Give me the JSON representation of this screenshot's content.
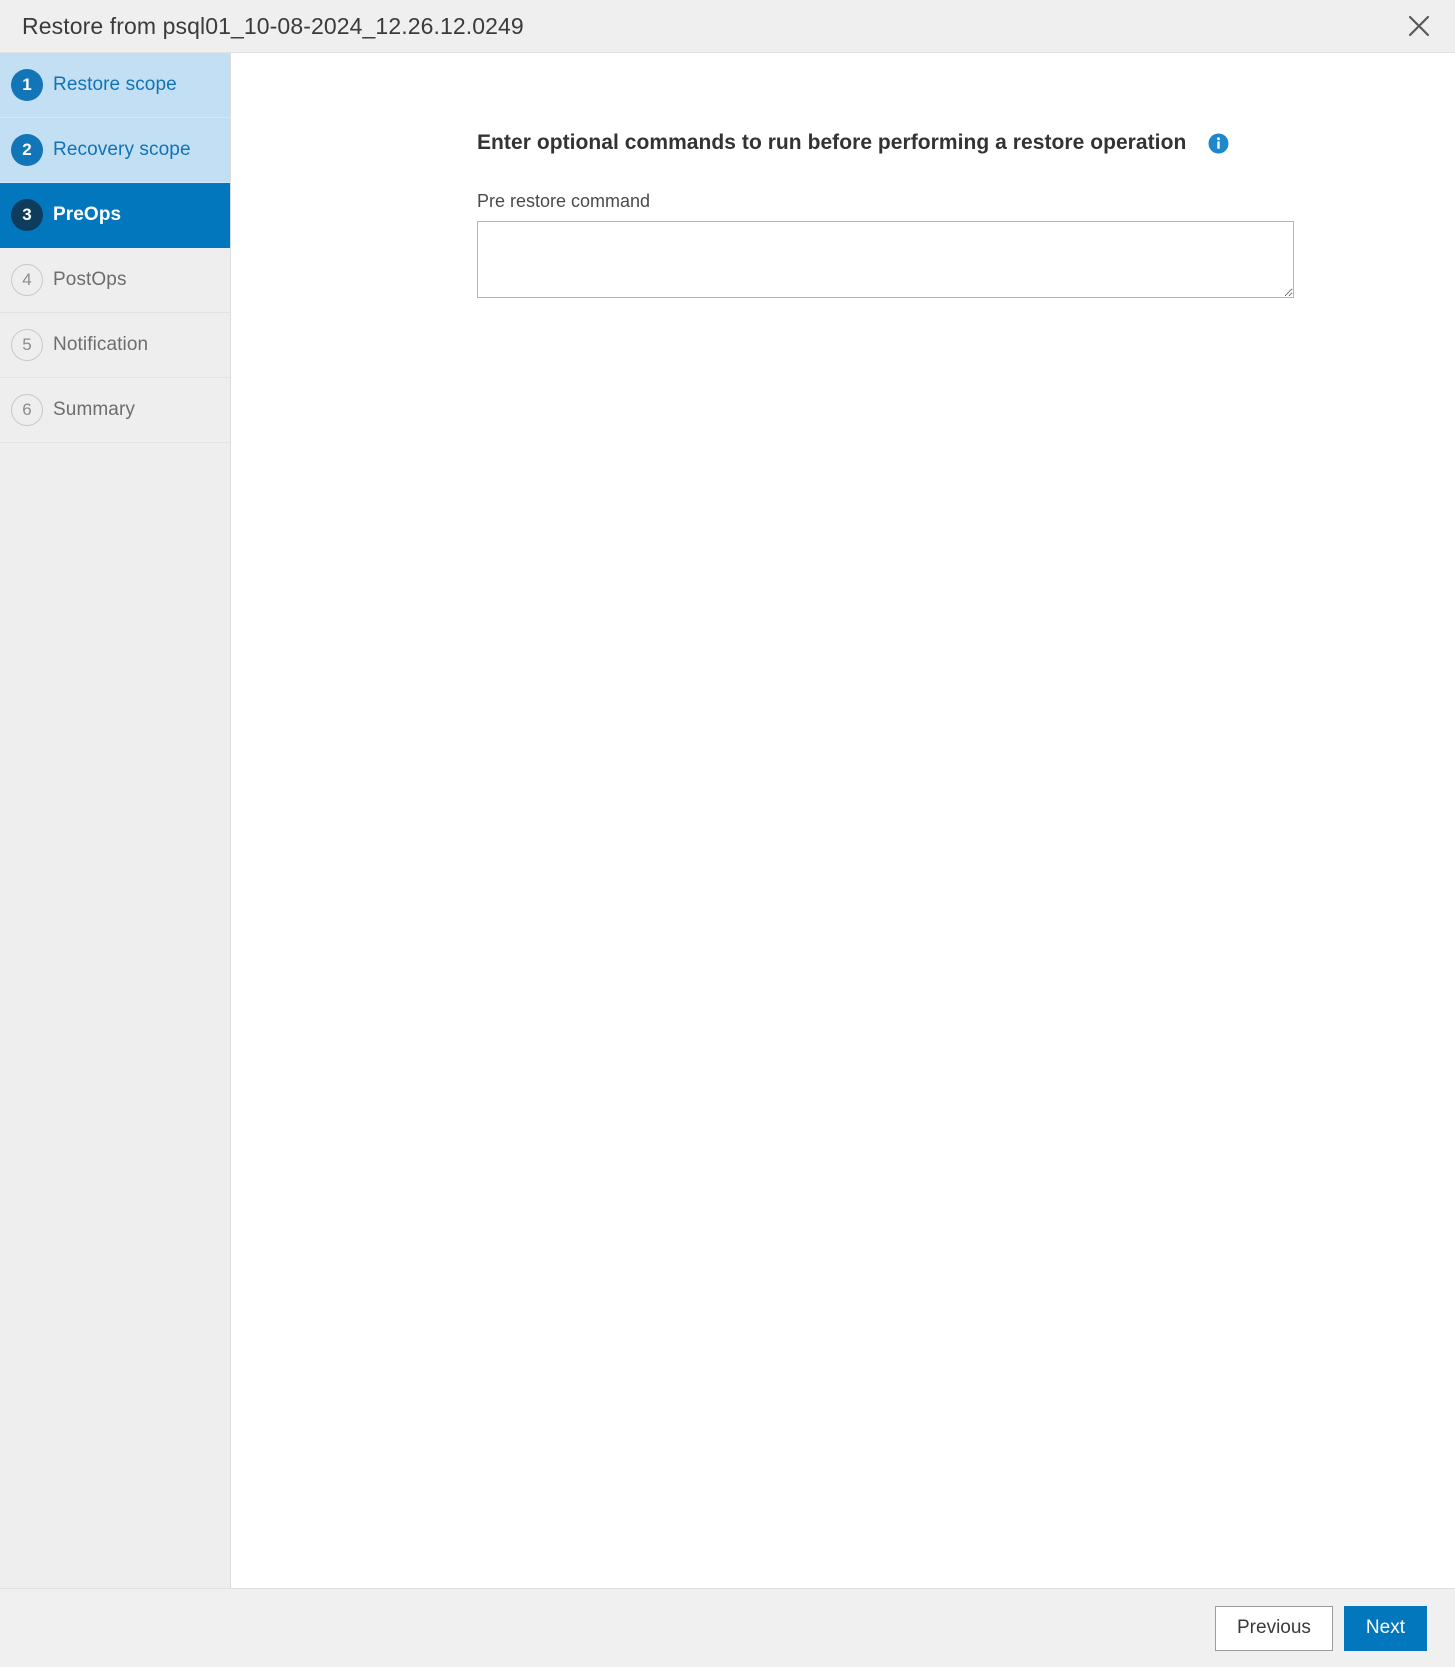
{
  "dialog": {
    "title": "Restore from psql01_10-08-2024_12.26.12.0249",
    "close_icon": "close-icon"
  },
  "sidebar": {
    "steps": [
      {
        "number": "1",
        "label": "Restore scope",
        "state": "done"
      },
      {
        "number": "2",
        "label": "Recovery scope",
        "state": "done"
      },
      {
        "number": "3",
        "label": "PreOps",
        "state": "active"
      },
      {
        "number": "4",
        "label": "PostOps",
        "state": "pending"
      },
      {
        "number": "5",
        "label": "Notification",
        "state": "pending"
      },
      {
        "number": "6",
        "label": "Summary",
        "state": "pending"
      }
    ]
  },
  "main": {
    "heading": "Enter optional commands to run before performing a restore operation",
    "info_icon": "info-icon",
    "field": {
      "label": "Pre restore command",
      "value": "",
      "placeholder": ""
    }
  },
  "footer": {
    "previous_label": "Previous",
    "next_label": "Next"
  },
  "colors": {
    "accent": "#0277bd",
    "step_done_bg": "#c3dff3",
    "step_done_text": "#1173b6",
    "step_active_bg": "#0277bd",
    "step_active_circle": "#0d3c5c",
    "sidebar_bg": "#eeeeee",
    "titlebar_bg": "#efefef",
    "footer_bg": "#f0f0f0",
    "info_icon": "#1e88cc"
  }
}
